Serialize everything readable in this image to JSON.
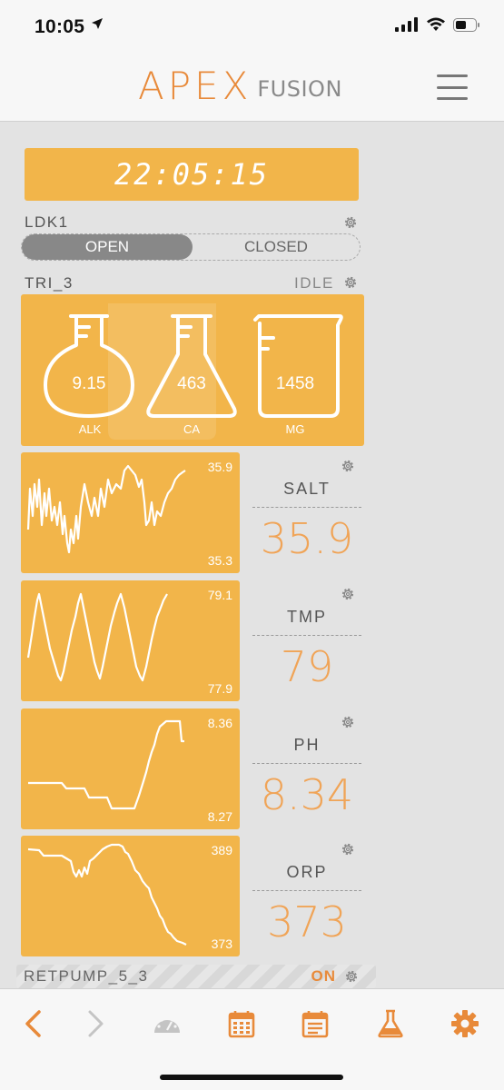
{
  "status_bar": {
    "time": "10:05"
  },
  "header": {
    "brand_main": "APEX",
    "brand_sub": "FUSION"
  },
  "clock": {
    "time": "22:05:15"
  },
  "ldk1": {
    "name": "LDK1",
    "option_open": "OPEN",
    "option_closed": "CLOSED",
    "selected": "OPEN"
  },
  "tri": {
    "name": "TRI_3",
    "state": "IDLE",
    "flasks": [
      {
        "label": "ALK",
        "value": "9.15"
      },
      {
        "label": "CA",
        "value": "463"
      },
      {
        "label": "MG",
        "value": "1458"
      }
    ]
  },
  "probes": [
    {
      "name": "SALT",
      "value": "35.9",
      "graph_max": "35.9",
      "graph_min": "35.3"
    },
    {
      "name": "TMP",
      "value": "79",
      "graph_max": "79.1",
      "graph_min": "77.9"
    },
    {
      "name": "PH",
      "value": "8.34",
      "graph_max": "8.36",
      "graph_min": "8.27"
    },
    {
      "name": "ORP",
      "value": "373",
      "graph_max": "389",
      "graph_min": "373"
    }
  ],
  "retpump": {
    "name": "RETPUMP_5_3",
    "state": "ON"
  },
  "tabbar": {
    "icons": [
      "back-arrow-icon",
      "forward-arrow-icon",
      "dashboard-gauge-icon",
      "calendar-icon",
      "notes-calendar-icon",
      "flask-icon",
      "settings-gear-icon"
    ]
  },
  "colors": {
    "tile": "#f2b54a",
    "accent": "#e88a3a",
    "value": "#f0a457",
    "background": "#e3e3e3"
  }
}
